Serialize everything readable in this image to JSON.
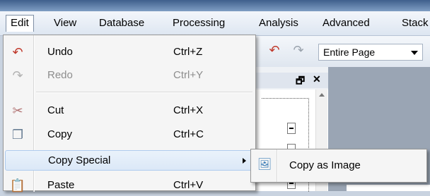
{
  "menubar": {
    "items": [
      {
        "label": "Edit"
      },
      {
        "label": "View"
      },
      {
        "label": "Database"
      },
      {
        "label": "Processing"
      },
      {
        "label": "Analysis"
      },
      {
        "label": "Advanced"
      },
      {
        "label": "Stack"
      }
    ]
  },
  "toolbar": {
    "zoom_value": "Entire Page",
    "icons": [
      "undo-icon",
      "redo-icon"
    ]
  },
  "panel": {
    "restore_glyph": "🗗",
    "close_glyph": "✕"
  },
  "edit_menu": {
    "items": [
      {
        "label": "Undo",
        "shortcut": "Ctrl+Z",
        "icon": "undo-icon",
        "enabled": true
      },
      {
        "label": "Redo",
        "shortcut": "Ctrl+Y",
        "icon": "redo-icon",
        "enabled": false
      },
      {
        "label": "Cut",
        "shortcut": "Ctrl+X",
        "icon": "scissors-icon",
        "enabled": true
      },
      {
        "label": "Copy",
        "shortcut": "Ctrl+C",
        "icon": "copy-icon",
        "enabled": true
      },
      {
        "label": "Copy Special",
        "shortcut": "",
        "icon": "",
        "enabled": true,
        "has_submenu": true,
        "highlighted": true
      },
      {
        "label": "Paste",
        "shortcut": "Ctrl+V",
        "icon": "paste-icon",
        "enabled": true
      }
    ]
  },
  "copy_special_submenu": {
    "items": [
      {
        "label": "Copy as Image",
        "icon": "image-icon"
      }
    ]
  },
  "colors": {
    "undo_red": "#c0392b",
    "disabled_text": "#8d8d8d",
    "highlight_border": "#aecbee"
  }
}
